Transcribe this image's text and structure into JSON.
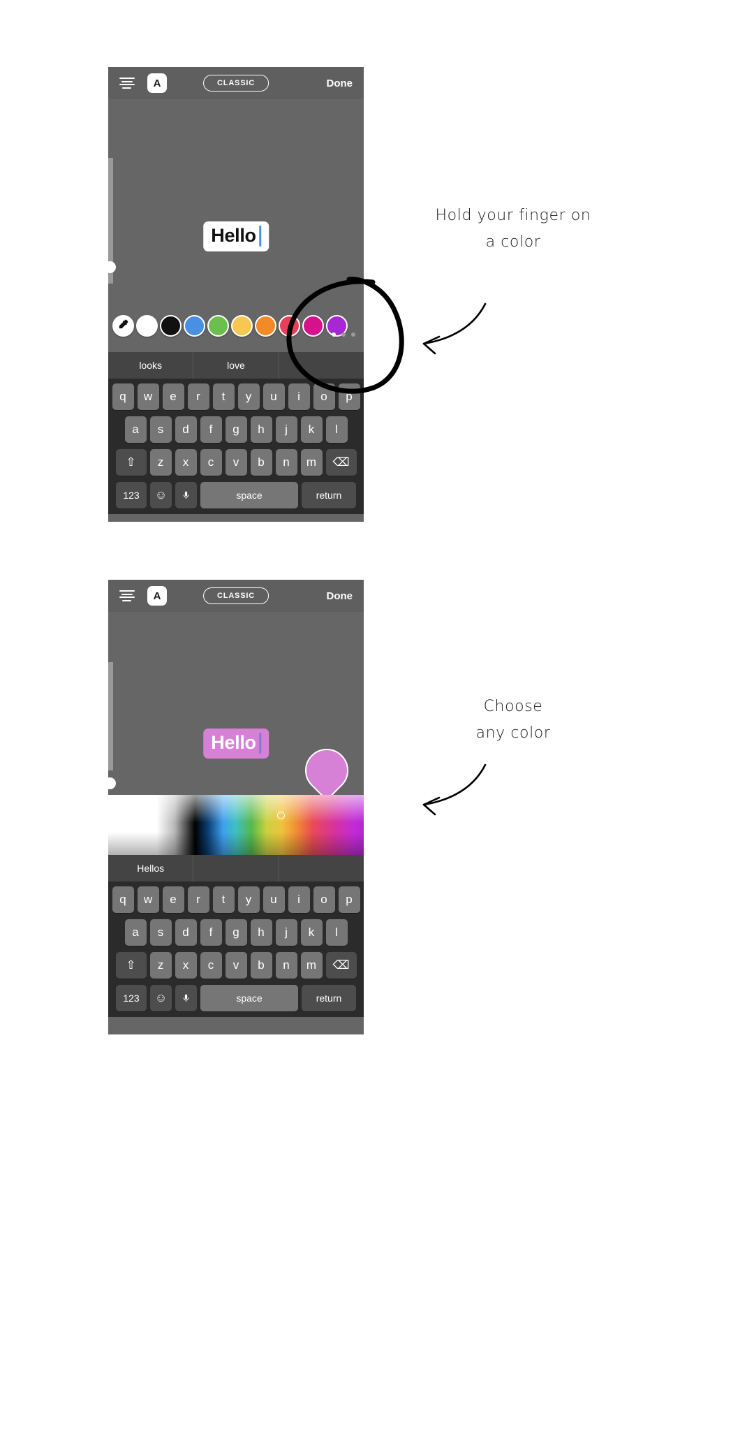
{
  "screens": [
    {
      "id": "screen-hold",
      "topbar": {
        "align_icon": "text-align-icon",
        "font_button_label": "A",
        "font_style_label": "CLASSIC",
        "done_label": "Done"
      },
      "canvas": {
        "text_value": "Hello",
        "text_bg": "#ffffff",
        "text_color": "#111111",
        "caret_color": "#4a90e2"
      },
      "palette": {
        "eyedropper_glyph": "⟋",
        "swatches": [
          {
            "name": "swatch-eyedropper",
            "color": "#ffffff"
          },
          {
            "name": "swatch-white",
            "color": "#ffffff"
          },
          {
            "name": "swatch-black",
            "color": "#111111"
          },
          {
            "name": "swatch-blue",
            "color": "#4a90e2"
          },
          {
            "name": "swatch-green",
            "color": "#6bbf4e"
          },
          {
            "name": "swatch-yellow",
            "color": "#f7c74f"
          },
          {
            "name": "swatch-orange",
            "color": "#f28a28"
          },
          {
            "name": "swatch-red",
            "color": "#e8405a"
          },
          {
            "name": "swatch-magenta",
            "color": "#d5118c"
          },
          {
            "name": "swatch-purple",
            "color": "#a726d6"
          }
        ],
        "page_dots": 3,
        "active_dot": 0
      },
      "keyboard": {
        "suggestions": [
          "looks",
          "love",
          ""
        ],
        "row1": [
          "q",
          "w",
          "e",
          "r",
          "t",
          "y",
          "u",
          "i",
          "o",
          "p"
        ],
        "row2": [
          "a",
          "s",
          "d",
          "f",
          "g",
          "h",
          "j",
          "k",
          "l"
        ],
        "row3": [
          "z",
          "x",
          "c",
          "v",
          "b",
          "n",
          "m"
        ],
        "shift_glyph": "⇧",
        "backspace_glyph": "⌫",
        "num_label": "123",
        "emoji_glyph": "☺",
        "mic_glyph": "🎤",
        "space_label": "space",
        "return_label": "return"
      }
    },
    {
      "id": "screen-choose",
      "topbar": {
        "align_icon": "text-align-icon",
        "font_button_label": "A",
        "font_style_label": "CLASSIC",
        "done_label": "Done"
      },
      "canvas": {
        "text_value": "Hello",
        "text_bg": "#d680d6",
        "text_color": "#ffffff",
        "caret_color": "#7b7bd6",
        "pin_color": "#d680d6"
      },
      "spectrum": {
        "cursor_x_pct": 66,
        "cursor_y_pct": 28
      },
      "keyboard": {
        "suggestions": [
          "Hellos",
          "",
          ""
        ],
        "row1": [
          "q",
          "w",
          "e",
          "r",
          "t",
          "y",
          "u",
          "i",
          "o",
          "p"
        ],
        "row2": [
          "a",
          "s",
          "d",
          "f",
          "g",
          "h",
          "j",
          "k",
          "l"
        ],
        "row3": [
          "z",
          "x",
          "c",
          "v",
          "b",
          "n",
          "m"
        ],
        "shift_glyph": "⇧",
        "backspace_glyph": "⌫",
        "num_label": "123",
        "emoji_glyph": "☺",
        "mic_glyph": "🎤",
        "space_label": "space",
        "return_label": "return"
      }
    }
  ],
  "annotations": {
    "note_1": "Hold your finger on\na color",
    "note_2": "Choose\nany color"
  }
}
